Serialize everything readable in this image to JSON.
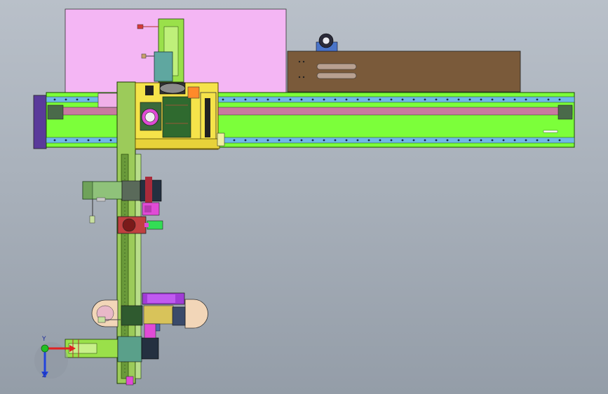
{
  "viewport": {
    "background_top": "#b9c0c9",
    "background_bottom": "#949da8"
  },
  "model": {
    "colors": {
      "rail_green": "#7cff3a",
      "rail_outline": "#1a4a00",
      "rail_pink": "#c87aa0",
      "rail_blue": "#6fb7e8",
      "panel_pink": "#f4b6f4",
      "panel_brown": "#7a5a3a",
      "column_green": "#9ccb5a",
      "yellow": "#f5e34a",
      "magenta": "#e04bd6",
      "purple": "#a03cd6",
      "end_plate": "#5a3a9a",
      "motor_green": "#8fc27a",
      "teal": "#5fa7a0",
      "red": "#d63a3a",
      "bright_green": "#33dd55",
      "gold": "#d8c35a"
    }
  },
  "triad": {
    "axis_y_label": "Y",
    "axis_z_label": "Z",
    "x_color": "#e02222",
    "y_color": "#22c022",
    "z_color": "#2244dd"
  }
}
